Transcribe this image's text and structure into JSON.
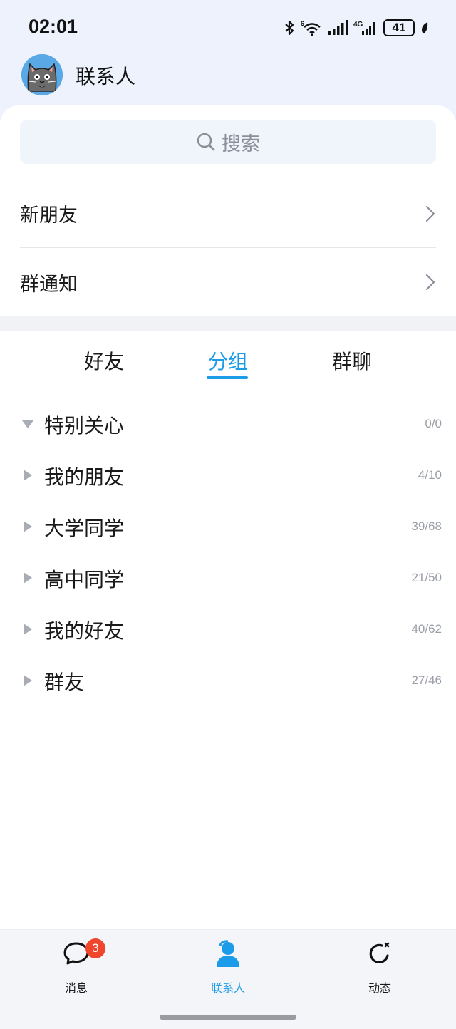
{
  "status_bar": {
    "time": "02:01",
    "battery": "41",
    "icons": [
      "bluetooth-icon",
      "wifi-icon",
      "signal-icon",
      "signal-4g-icon",
      "battery-icon",
      "leaf-icon"
    ]
  },
  "header": {
    "title": "联系人",
    "avatar": "cat-avatar"
  },
  "search": {
    "placeholder": "搜索"
  },
  "entries": [
    {
      "label": "新朋友"
    },
    {
      "label": "群通知"
    }
  ],
  "tabs": [
    {
      "label": "好友",
      "active": false
    },
    {
      "label": "分组",
      "active": true
    },
    {
      "label": "群聊",
      "active": false
    }
  ],
  "groups": [
    {
      "name": "特别关心",
      "count": "0/0",
      "expanded": true
    },
    {
      "name": "我的朋友",
      "count": "4/10",
      "expanded": false
    },
    {
      "name": "大学同学",
      "count": "39/68",
      "expanded": false
    },
    {
      "name": "高中同学",
      "count": "21/50",
      "expanded": false
    },
    {
      "name": "我的好友",
      "count": "40/62",
      "expanded": false
    },
    {
      "name": "群友",
      "count": "27/46",
      "expanded": false
    }
  ],
  "bottom_nav": [
    {
      "label": "消息",
      "icon": "chat-bubble-icon",
      "badge": "3",
      "active": false
    },
    {
      "label": "联系人",
      "icon": "person-icon",
      "active": true
    },
    {
      "label": "动态",
      "icon": "refresh-star-icon",
      "active": false
    }
  ],
  "colors": {
    "accent": "#1c9ce8",
    "badge": "#f0462d",
    "header_bg": "#edf2fc"
  }
}
